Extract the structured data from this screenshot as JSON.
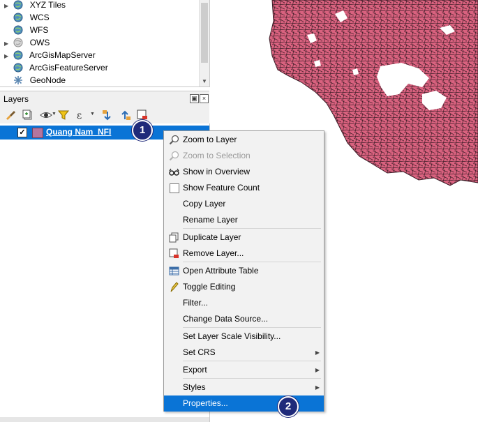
{
  "browser": {
    "items": [
      {
        "label": "XYZ Tiles",
        "expandable": true,
        "icon": "globe-icon"
      },
      {
        "label": "WCS",
        "expandable": false,
        "icon": "globe-icon"
      },
      {
        "label": "WFS",
        "expandable": false,
        "icon": "globe-icon"
      },
      {
        "label": "OWS",
        "expandable": true,
        "icon": "globe-icon"
      },
      {
        "label": "ArcGisMapServer",
        "expandable": true,
        "icon": "globe-icon"
      },
      {
        "label": "ArcGisFeatureServer",
        "expandable": false,
        "icon": "globe-icon"
      },
      {
        "label": "GeoNode",
        "expandable": false,
        "icon": "geonode-icon"
      }
    ]
  },
  "layers_panel": {
    "title": "Layers",
    "layer": {
      "name": "Quang Nam_NFI",
      "checked": true,
      "color": "#b5759e"
    }
  },
  "badges": {
    "one": "1",
    "two": "2"
  },
  "context_menu": {
    "items": {
      "zoom_to_layer": "Zoom to Layer",
      "zoom_to_selection": "Zoom to Selection",
      "show_in_overview": "Show in Overview",
      "show_feature_count": "Show Feature Count",
      "copy_layer": "Copy Layer",
      "rename_layer": "Rename Layer",
      "duplicate_layer": "Duplicate Layer",
      "remove_layer": "Remove Layer...",
      "open_attribute_table": "Open Attribute Table",
      "toggle_editing": "Toggle Editing",
      "filter": "Filter...",
      "change_data_source": "Change Data Source...",
      "set_scale_visibility": "Set Layer Scale Visibility...",
      "set_crs": "Set CRS",
      "export": "Export",
      "styles": "Styles",
      "properties": "Properties..."
    }
  },
  "colors": {
    "selection": "#0a74d6",
    "map_fill": "#d9627f",
    "badge": "#1f2a7a"
  }
}
